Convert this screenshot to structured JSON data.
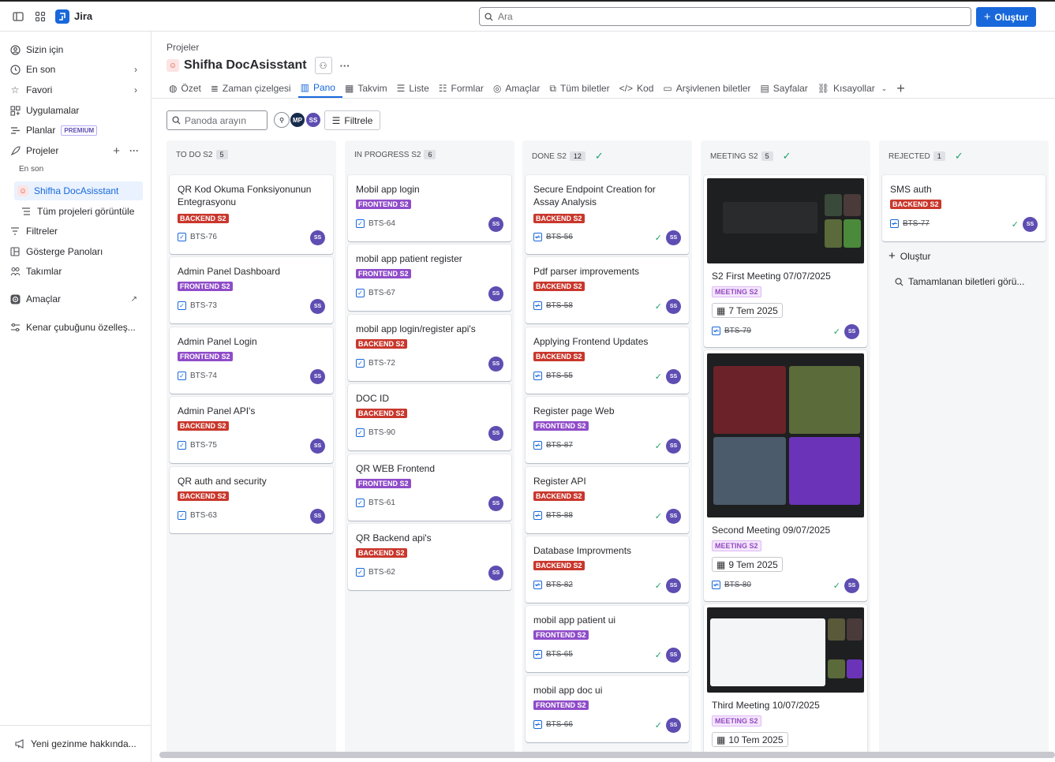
{
  "app": {
    "name": "Jira",
    "search_placeholder": "Ara",
    "create_label": "Oluştur"
  },
  "sidebar": {
    "items": [
      {
        "label": "Sizin için",
        "icon": "user-icon"
      },
      {
        "label": "En son",
        "icon": "clock-icon"
      },
      {
        "label": "Favori",
        "icon": "star-icon"
      },
      {
        "label": "Uygulamalar",
        "icon": "apps-icon"
      },
      {
        "label": "Planlar",
        "icon": "plans-icon",
        "badge": "PREMIUM"
      },
      {
        "label": "Projeler",
        "icon": "rocket-icon"
      }
    ],
    "recent_heading": "En son",
    "project": "Shifha DocAsisstant",
    "all_projects": "Tüm projeleri görüntüle",
    "items2": [
      {
        "label": "Filtreler",
        "icon": "filter-icon"
      },
      {
        "label": "Gösterge Panoları",
        "icon": "dashboard-icon"
      },
      {
        "label": "Takımlar",
        "icon": "teams-icon"
      }
    ],
    "goals": "Amaçlar",
    "customize": "Kenar çubuğunu özelleş...",
    "footer": "Yeni gezinme hakkında..."
  },
  "project": {
    "breadcrumb": "Projeler",
    "title": "Shifha DocAsisstant"
  },
  "tabs": [
    "Özet",
    "Zaman çizelgesi",
    "Pano",
    "Takvim",
    "Liste",
    "Formlar",
    "Amaçlar",
    "Tüm biletler",
    "Kod",
    "Arşivlenen biletler",
    "Sayfalar",
    "Kısayollar"
  ],
  "board": {
    "search_placeholder": "Panoda arayın",
    "filter_label": "Filtrele",
    "avatars": [
      "MP",
      "SS"
    ],
    "add_card": "Oluştur",
    "view_done": "Tamamlanan biletleri görü...",
    "columns": [
      {
        "title": "TO DO S2",
        "count": "5",
        "done": false,
        "cards": [
          {
            "title": "QR Kod Okuma Fonksiyonunun Entegrasyonu",
            "label": "BACKEND S2",
            "key": "BTS-76"
          },
          {
            "title": "Admin Panel Dashboard",
            "label": "FRONTEND S2",
            "key": "BTS-73"
          },
          {
            "title": "Admin Panel Login",
            "label": "FRONTEND S2",
            "key": "BTS-74"
          },
          {
            "title": "Admin Panel API's",
            "label": "BACKEND S2",
            "key": "BTS-75"
          },
          {
            "title": "QR auth and security",
            "label": "BACKEND S2",
            "key": "BTS-63"
          }
        ]
      },
      {
        "title": "IN PROGRESS S2",
        "count": "6",
        "done": false,
        "cards": [
          {
            "title": "Mobil app login",
            "label": "FRONTEND S2",
            "key": "BTS-64"
          },
          {
            "title": "mobil app patient register",
            "label": "FRONTEND S2",
            "key": "BTS-67"
          },
          {
            "title": "mobil app login/register api's",
            "label": "BACKEND S2",
            "key": "BTS-72"
          },
          {
            "title": "DOC ID",
            "label": "BACKEND S2",
            "key": "BTS-90"
          },
          {
            "title": "QR WEB Frontend",
            "label": "FRONTEND S2",
            "key": "BTS-61"
          },
          {
            "title": "QR Backend api's",
            "label": "BACKEND S2",
            "key": "BTS-62"
          }
        ]
      },
      {
        "title": "DONE S2",
        "count": "12",
        "done": true,
        "cards": [
          {
            "title": "Secure Endpoint Creation for Assay Analysis",
            "label": "BACKEND S2",
            "key": "BTS-56"
          },
          {
            "title": "Pdf parser improvements",
            "label": "BACKEND S2",
            "key": "BTS-58"
          },
          {
            "title": "Applying Frontend Updates",
            "label": "BACKEND S2",
            "key": "BTS-55"
          },
          {
            "title": "Register page Web",
            "label": "FRONTEND S2",
            "key": "BTS-87"
          },
          {
            "title": "Register API",
            "label": "BACKEND S2",
            "key": "BTS-88"
          },
          {
            "title": "Database Improvments",
            "label": "BACKEND S2",
            "key": "BTS-82"
          },
          {
            "title": "mobil app patient ui",
            "label": "FRONTEND S2",
            "key": "BTS-65"
          },
          {
            "title": "mobil app doc ui",
            "label": "FRONTEND S2",
            "key": "BTS-66"
          }
        ]
      },
      {
        "title": "MEETING S2",
        "count": "5",
        "done": true,
        "cards": [
          {
            "title": "S2 First Meeting 07/07/2025",
            "label": "MEETING S2",
            "date": "7 Tem 2025",
            "key": "BTS-79"
          },
          {
            "title": "Second Meeting 09/07/2025",
            "label": "MEETING S2",
            "date": "9 Tem 2025",
            "key": "BTS-80"
          },
          {
            "title": "Third Meeting 10/07/2025",
            "label": "MEETING S2",
            "date": "10 Tem 2025",
            "key": ""
          }
        ]
      },
      {
        "title": "REJECTED",
        "count": "1",
        "done": true,
        "cards": [
          {
            "title": "SMS auth",
            "label": "BACKEND S2",
            "key": "BTS-77"
          }
        ]
      }
    ],
    "user_initials": "SS"
  },
  "colors": {
    "accent": "#1868db",
    "backend": "#c9372c",
    "frontend": "#8f4cc9",
    "meeting": "#964ac0",
    "done_check": "#22a06b"
  }
}
